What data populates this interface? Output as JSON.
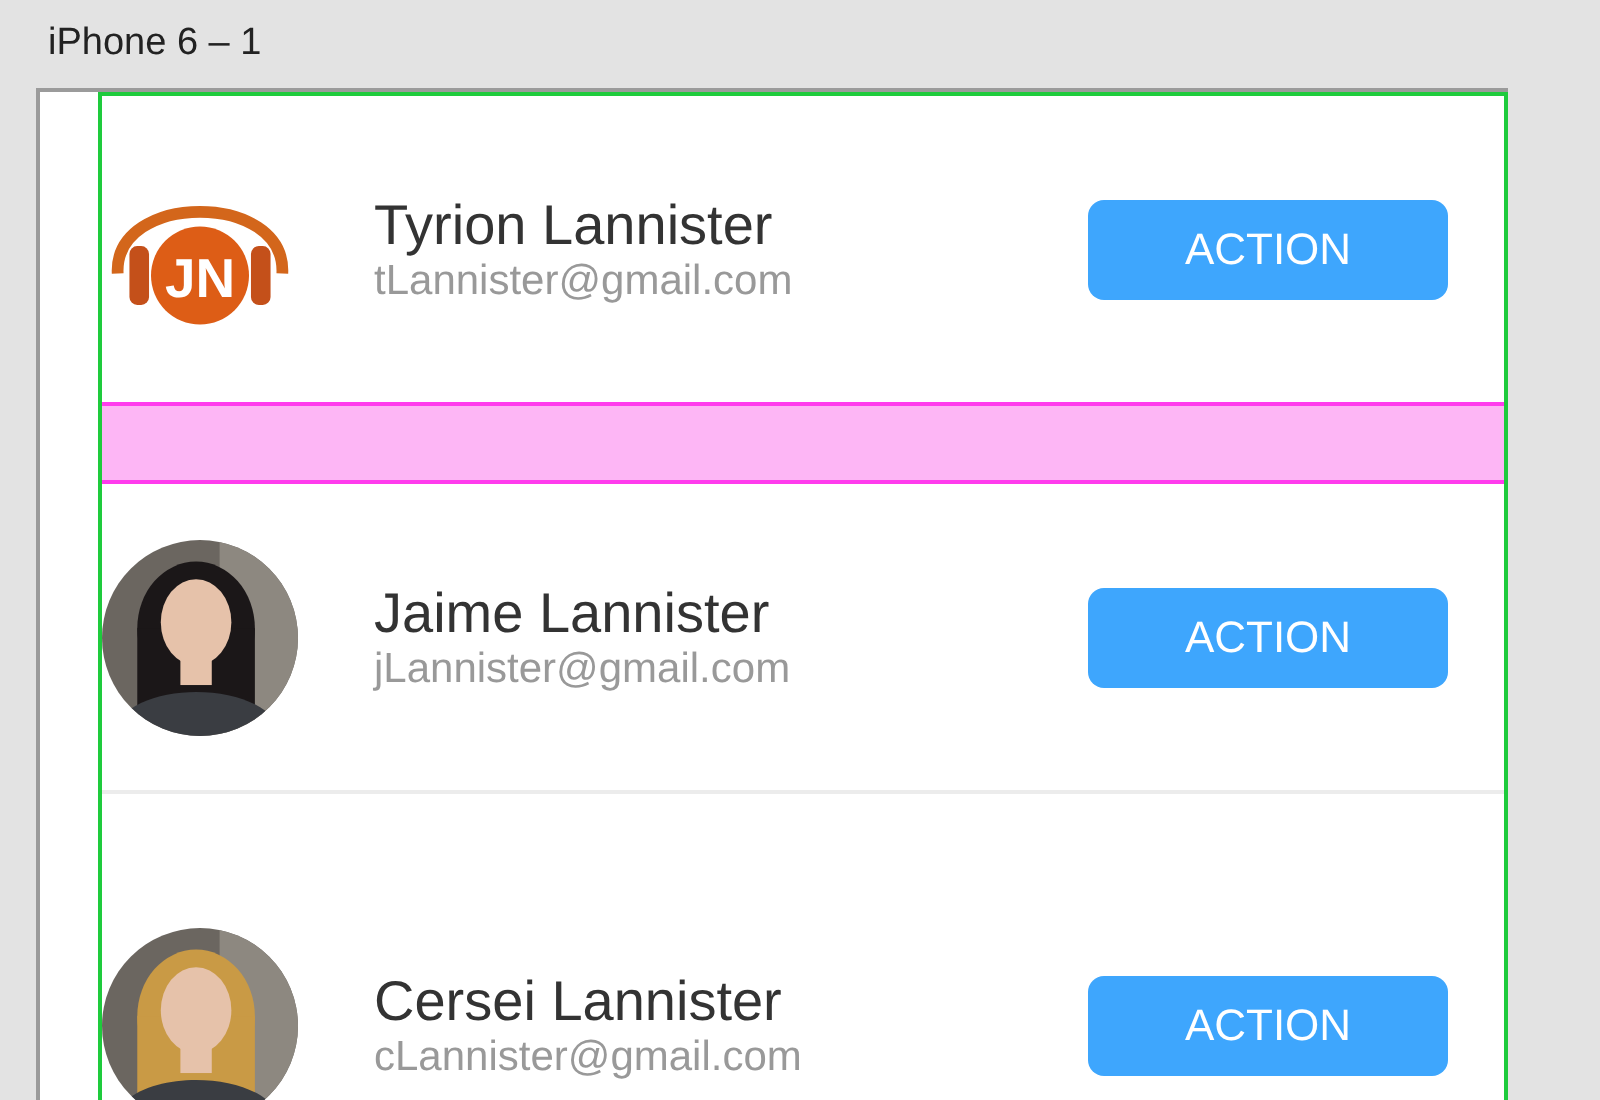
{
  "artboard": {
    "title": "iPhone 6 – 1"
  },
  "rows": [
    {
      "kind": "contact",
      "avatar": {
        "kind": "logo",
        "text": "JN"
      },
      "name": "Tyrion Lannister",
      "email": "tLannister@gmail.com",
      "button": "ACTION"
    },
    {
      "kind": "spacer"
    },
    {
      "kind": "contact",
      "name": "Jaime Lannister",
      "email": "jLannister@gmail.com",
      "button": "ACTION"
    },
    {
      "kind": "contact",
      "name": "Cersei Lannister",
      "email": "cLannister@gmail.com",
      "button": "ACTION"
    }
  ]
}
